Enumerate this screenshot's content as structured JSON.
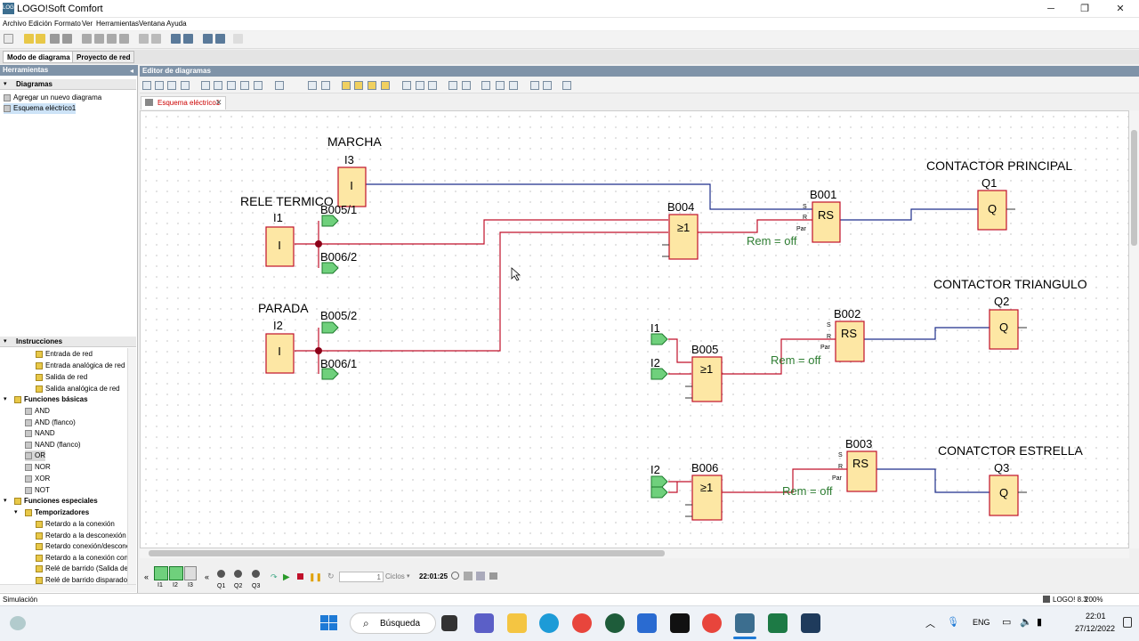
{
  "window": {
    "title": "LOGO!Soft Comfort",
    "minimize": "─",
    "maximize": "❐",
    "close": "✕"
  },
  "menu": [
    "Archivo",
    "Edición",
    "Formato",
    "Ver",
    "Herramientas",
    "Ventana",
    "Ayuda"
  ],
  "mode_tabs": [
    "Modo de diagrama",
    "Proyecto de red"
  ],
  "left": {
    "tools_header": "Herramientas",
    "diagrams_header": "Diagramas",
    "diagram_items": [
      "Agregar un nuevo diagrama",
      "Esquema eléctrico1"
    ],
    "instructions_header": "Instrucciones",
    "network_items": [
      "Entrada de red",
      "Entrada analógica de red",
      "Salida de red",
      "Salida analógica de red"
    ],
    "basic_header": "Funciones básicas",
    "basic_items": [
      "AND",
      "AND (flanco)",
      "NAND",
      "NAND (flanco)",
      "OR",
      "NOR",
      "XOR",
      "NOT"
    ],
    "special_header": "Funciones especiales",
    "timers_header": "Temporizadores",
    "timer_items": [
      "Retardo a la conexión",
      "Retardo a la desconexión",
      "Retardo conexión/desconexión",
      "Retardo a la conexión con m",
      "Relé de barrido (Salida de im",
      "Relé de barrido disparado po"
    ]
  },
  "editor": {
    "header": "Editor de diagramas",
    "tab": "Esquema eléctrico1"
  },
  "diagram": {
    "labels": {
      "marcha": "MARCHA",
      "rele": "RELE TERMICO",
      "parada": "PARADA",
      "cp": "CONTACTOR PRINCIPAL",
      "ct": "CONTACTOR TRIANGULO",
      "ce": "CONATCTOR ESTRELLA"
    },
    "ids": {
      "i3": "I3",
      "i1": "I1",
      "i2": "I2",
      "b005_1": "B005/1",
      "b006_2": "B006/2",
      "b005_2": "B005/2",
      "b006_1": "B006/1",
      "b004": "B004",
      "b001": "B001",
      "b002": "B002",
      "b003": "B003",
      "b005": "B005",
      "b006": "B006",
      "q1": "Q1",
      "q2": "Q2",
      "q3": "Q3",
      "i1b": "I1",
      "i2b": "I2",
      "i2c": "I2"
    },
    "sym": {
      "input": "I",
      "or": "≥1",
      "rs": "RS",
      "q": "Q",
      "s": "S",
      "r": "R",
      "par": "Par"
    },
    "rem": "Rem = off",
    "colors": {
      "wire_blue": "#1f2f8c",
      "wire_red": "#c0102a",
      "block_fill": "#fde7a4",
      "block_border": "#c0102a",
      "flag_green": "#6fd07c",
      "text_green": "#2e7d32"
    }
  },
  "sim": {
    "inputs": [
      "I1",
      "I2",
      "I3"
    ],
    "outputs": [
      "Q1",
      "Q2",
      "Q3"
    ],
    "cycles_value": "1",
    "cycles_unit": "Ciclos",
    "time": "22:01:25"
  },
  "status": {
    "left": "Simulación",
    "device": "LOGO! 8.3",
    "zoom": "200%"
  },
  "taskbar": {
    "search": "Búsqueda",
    "lang": "ENG",
    "time": "22:01",
    "date": "27/12/2022"
  }
}
